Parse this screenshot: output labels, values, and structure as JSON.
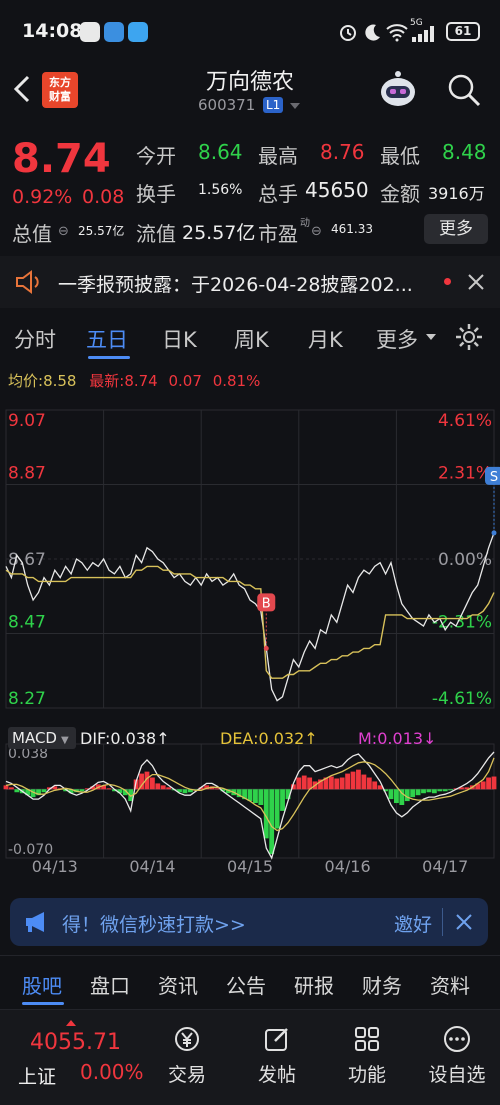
{
  "status": {
    "time": "14:08",
    "battery": "61",
    "net": "5G"
  },
  "header": {
    "logo_text_1": "东方",
    "logo_text_2": "财富",
    "name": "万向德农",
    "code": "600371",
    "level": "L1"
  },
  "quote": {
    "price": "8.74",
    "change_pct": "0.92%",
    "change": "0.08",
    "open_label": "今开",
    "open": "8.64",
    "high_label": "最高",
    "high": "8.76",
    "low_label": "最低",
    "low": "8.48",
    "turnover_label": "换手",
    "turnover": "1.56%",
    "volume_label": "总手",
    "volume": "45650",
    "amount_label": "金额",
    "amount": "3916万",
    "mktcap_label": "总值",
    "mktcap": "25.57亿",
    "float_label": "流值",
    "float": "25.57亿",
    "pe_label": "市盈",
    "pe_sup": "动",
    "pe": "461.33",
    "more": "更多"
  },
  "notice": {
    "text": "一季报预披露：于2026-04-28披露202..."
  },
  "tabs": {
    "items": [
      "分时",
      "五日",
      "日K",
      "周K",
      "月K",
      "更多"
    ],
    "active": 1
  },
  "chart_data": {
    "type": "line",
    "legend_line": {
      "avg_label": "均价:",
      "avg": "8.58",
      "latest_label": "最新:",
      "latest": "8.74",
      "change": "0.07",
      "pct": "0.81%"
    },
    "y_left": [
      "9.07",
      "8.87",
      "8.67",
      "8.47",
      "8.27"
    ],
    "y_right": [
      "4.61%",
      "2.31%",
      "0.00%",
      "-2.31%",
      "-4.61%"
    ],
    "ylim": [
      8.27,
      9.07
    ],
    "prev_close": 8.67,
    "days": [
      "04/13",
      "04/14",
      "04/15",
      "04/16",
      "04/17"
    ],
    "series": [
      {
        "values": [
          8.65,
          8.62,
          8.68,
          8.66,
          8.6,
          8.56,
          8.58,
          8.62,
          8.6,
          8.64,
          8.62,
          8.65,
          8.63,
          8.67,
          8.66,
          8.64,
          8.66,
          8.65,
          8.67,
          8.64,
          8.63,
          8.65,
          8.62,
          8.63,
          8.68,
          8.66,
          8.7,
          8.69,
          8.67,
          8.66,
          8.64,
          8.62,
          8.63,
          8.61,
          8.6,
          8.62,
          8.6,
          8.63,
          8.61,
          8.62,
          8.6,
          8.61,
          8.63,
          8.6,
          8.59,
          8.56,
          8.55,
          8.53,
          8.43,
          8.32,
          8.29,
          8.3,
          8.35,
          8.4,
          8.38,
          8.42,
          8.45,
          8.43,
          8.48,
          8.47,
          8.52,
          8.5,
          8.55,
          8.6,
          8.58,
          8.62,
          8.64,
          8.63,
          8.65,
          8.66,
          8.63,
          8.66,
          8.6,
          8.55,
          8.53,
          8.51,
          8.5,
          8.49,
          8.52,
          8.5,
          8.51,
          8.48,
          8.5,
          8.49,
          8.52,
          8.55,
          8.58,
          8.6,
          8.65,
          8.7,
          8.74
        ]
      },
      {
        "values": [
          8.64,
          8.63,
          8.63,
          8.63,
          8.62,
          8.62,
          8.61,
          8.61,
          8.61,
          8.61,
          8.61,
          8.61,
          8.62,
          8.62,
          8.62,
          8.62,
          8.62,
          8.62,
          8.62,
          8.62,
          8.62,
          8.62,
          8.62,
          8.62,
          8.64,
          8.64,
          8.65,
          8.65,
          8.65,
          8.64,
          8.64,
          8.63,
          8.63,
          8.63,
          8.63,
          8.62,
          8.62,
          8.62,
          8.62,
          8.62,
          8.62,
          8.61,
          8.61,
          8.61,
          8.6,
          8.6,
          8.59,
          8.59,
          8.37,
          8.35,
          8.35,
          8.35,
          8.36,
          8.36,
          8.37,
          8.37,
          8.37,
          8.38,
          8.39,
          8.39,
          8.4,
          8.4,
          8.41,
          8.41,
          8.42,
          8.42,
          8.43,
          8.43,
          8.44,
          8.44,
          8.52,
          8.52,
          8.52,
          8.52,
          8.51,
          8.51,
          8.51,
          8.51,
          8.51,
          8.51,
          8.51,
          8.51,
          8.51,
          8.51,
          8.51,
          8.51,
          8.52,
          8.52,
          8.53,
          8.55,
          8.58
        ]
      }
    ],
    "markers": [
      {
        "label": "B",
        "index": 48,
        "value": 8.43,
        "color": "#e3484e"
      },
      {
        "label": "S",
        "index": 90,
        "value": 8.74,
        "color": "#3f7fd6"
      }
    ],
    "macd": {
      "selector": "MACD",
      "dif_label": "DIF:0.038↑",
      "dea_label": "DEA:0.032↑",
      "m_label": "M:0.013↓",
      "ylim": [
        -0.07,
        0.038
      ],
      "ymax_label": "0.038",
      "ymin_label": "-0.070",
      "hist": [
        0.004,
        0.002,
        -0.003,
        -0.004,
        -0.006,
        -0.008,
        -0.006,
        -0.003,
        0.002,
        0.003,
        0.001,
        -0.002,
        -0.004,
        -0.003,
        -0.002,
        0.001,
        0.003,
        0.005,
        0.004,
        0.001,
        -0.002,
        -0.004,
        -0.006,
        -0.012,
        0.01,
        0.016,
        0.018,
        0.012,
        0.006,
        0.004,
        0.002,
        -0.001,
        -0.003,
        -0.004,
        -0.003,
        -0.001,
        0.002,
        0.004,
        0.003,
        0.001,
        -0.002,
        -0.004,
        -0.006,
        -0.008,
        -0.01,
        -0.012,
        -0.014,
        -0.016,
        -0.05,
        -0.066,
        -0.04,
        -0.022,
        -0.01,
        0.005,
        0.012,
        0.014,
        0.012,
        0.008,
        0.01,
        0.012,
        0.013,
        0.011,
        0.012,
        0.016,
        0.018,
        0.02,
        0.015,
        0.012,
        0.008,
        0.004,
        -0.002,
        -0.01,
        -0.014,
        -0.016,
        -0.012,
        -0.008,
        -0.006,
        -0.004,
        -0.003,
        -0.004,
        -0.002,
        -0.002,
        -0.001,
        0.001,
        0.002,
        0.002,
        0.004,
        0.006,
        0.008,
        0.012,
        0.013
      ],
      "dif": [
        0.008,
        0.006,
        0.002,
        -0.002,
        -0.006,
        -0.01,
        -0.01,
        -0.006,
        0.0,
        0.004,
        0.004,
        0.0,
        -0.004,
        -0.006,
        -0.004,
        -0.001,
        0.003,
        0.007,
        0.008,
        0.005,
        0.0,
        -0.004,
        -0.01,
        -0.022,
        0.008,
        0.024,
        0.03,
        0.024,
        0.014,
        0.008,
        0.004,
        0.0,
        -0.004,
        -0.006,
        -0.006,
        -0.002,
        0.002,
        0.006,
        0.006,
        0.003,
        -0.002,
        -0.006,
        -0.01,
        -0.014,
        -0.018,
        -0.022,
        -0.026,
        -0.03,
        -0.06,
        -0.07,
        -0.05,
        -0.03,
        -0.012,
        0.006,
        0.018,
        0.024,
        0.024,
        0.018,
        0.02,
        0.022,
        0.024,
        0.022,
        0.024,
        0.03,
        0.034,
        0.036,
        0.03,
        0.024,
        0.016,
        0.008,
        -0.004,
        -0.016,
        -0.024,
        -0.028,
        -0.024,
        -0.018,
        -0.014,
        -0.01,
        -0.008,
        -0.008,
        -0.006,
        -0.005,
        -0.003,
        0.0,
        0.003,
        0.006,
        0.01,
        0.016,
        0.024,
        0.032,
        0.038
      ],
      "dea": [
        0.004,
        0.005,
        0.005,
        0.003,
        0.0,
        -0.003,
        -0.005,
        -0.005,
        -0.003,
        -0.001,
        0.0,
        0.001,
        0.0,
        -0.002,
        -0.003,
        -0.003,
        -0.001,
        0.002,
        0.004,
        0.005,
        0.004,
        0.002,
        -0.001,
        -0.007,
        -0.004,
        0.004,
        0.011,
        0.015,
        0.015,
        0.013,
        0.011,
        0.008,
        0.005,
        0.002,
        0.0,
        -0.001,
        -0.001,
        0.001,
        0.002,
        0.002,
        0.001,
        -0.001,
        -0.003,
        -0.006,
        -0.009,
        -0.012,
        -0.016,
        -0.019,
        -0.028,
        -0.038,
        -0.042,
        -0.04,
        -0.034,
        -0.026,
        -0.017,
        -0.008,
        0.0,
        0.004,
        0.008,
        0.011,
        0.014,
        0.016,
        0.018,
        0.021,
        0.024,
        0.027,
        0.028,
        0.027,
        0.025,
        0.021,
        0.016,
        0.01,
        0.003,
        -0.004,
        -0.008,
        -0.01,
        -0.011,
        -0.011,
        -0.011,
        -0.01,
        -0.009,
        -0.008,
        -0.007,
        -0.005,
        -0.003,
        -0.001,
        0.002,
        0.006,
        0.01,
        0.018,
        0.032
      ]
    }
  },
  "adbar": {
    "text": "得！微信秒速打款>>",
    "action": "邀好"
  },
  "bottom_tabs": {
    "items": [
      "股吧",
      "盘口",
      "资讯",
      "公告",
      "研报",
      "财务",
      "资料"
    ],
    "active": 0
  },
  "footer": {
    "index_value": "4055.71",
    "index_name": "上证",
    "index_pct": "0.00%",
    "items": [
      "交易",
      "发帖",
      "功能",
      "设自选"
    ]
  },
  "colors": {
    "up": "#f0363e",
    "down": "#2fd24b",
    "accent": "#4d8cf5",
    "avg_line": "#d8c15a",
    "dea_line": "#d8c15a"
  }
}
